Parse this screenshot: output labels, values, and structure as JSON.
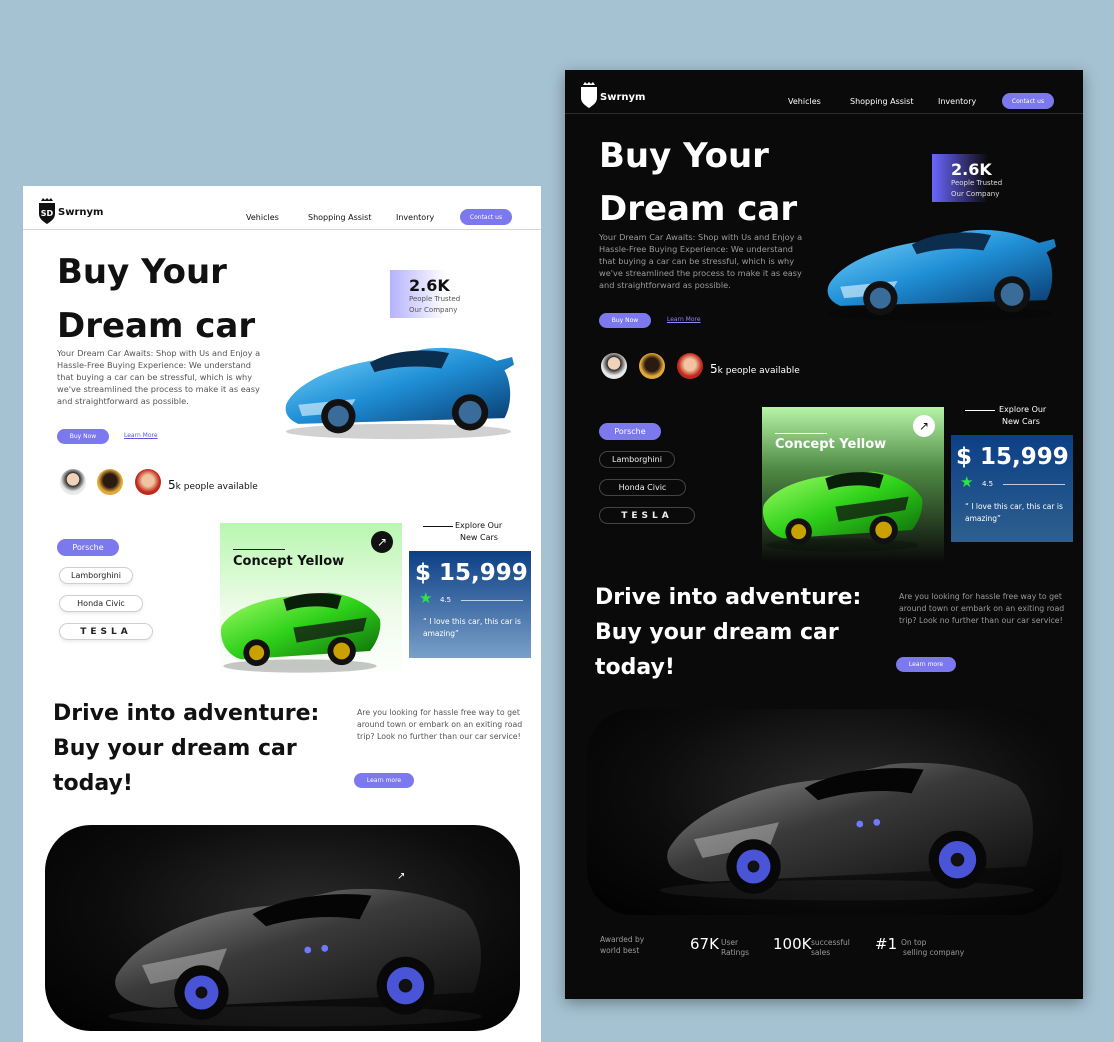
{
  "brand": {
    "name": "Swrnym"
  },
  "nav": {
    "items": [
      "Vehicles",
      "Shopping Assist",
      "Inventory"
    ],
    "contact_label": "Contact us"
  },
  "hero": {
    "title_line1": "Buy Your",
    "title_line2": "Dream car",
    "description": "Your Dream Car Awaits: Shop with Us and Enjoy a Hassle-Free Buying Experience: We understand that buying a car can be stressful, which is why we've streamlined the process to make it as easy and straightforward as possible.",
    "buy_label": "Buy Now",
    "learn_label": "Learn More",
    "trust_number": "2.6K",
    "trust_label_line1": "People Trusted",
    "trust_label_line2": "Our Company"
  },
  "availability": {
    "count": "5",
    "suffix": "k",
    "label": "people available"
  },
  "brands": {
    "items": [
      "Porsche",
      "Lamborghini",
      "Honda Civic",
      "TESLA"
    ]
  },
  "featured": {
    "concept_title": "Concept Yellow",
    "explore_line1": "Explore Our",
    "explore_line2": "New Cars",
    "price": "$ 15,999",
    "rating": "4.5",
    "review": "“ I love this car, this car is amazing”"
  },
  "adventure": {
    "title_line1": "Drive into adventure:",
    "title_line2": "Buy your dream car",
    "title_line3": "today!",
    "description": "Are you looking for hassle free way to get around town or embark on an exiting road trip? Look no further than our car service!",
    "learn_label": "Learn more"
  },
  "stats": {
    "award_line1": "Awarded by",
    "award_line2": "world best",
    "ratings_num": "67K",
    "ratings_lbl1": "User",
    "ratings_lbl2": "Ratings",
    "sales_num": "100K",
    "sales_lbl1": "successful",
    "sales_lbl2": "sales",
    "rank_num": "#1",
    "rank_lbl1": "On top",
    "rank_lbl2": "selling company"
  },
  "colors": {
    "accent": "#7c79ee",
    "price_card": "#0c3f86",
    "concept_green": "#b8f7b0",
    "background": "#a5c2d2"
  }
}
